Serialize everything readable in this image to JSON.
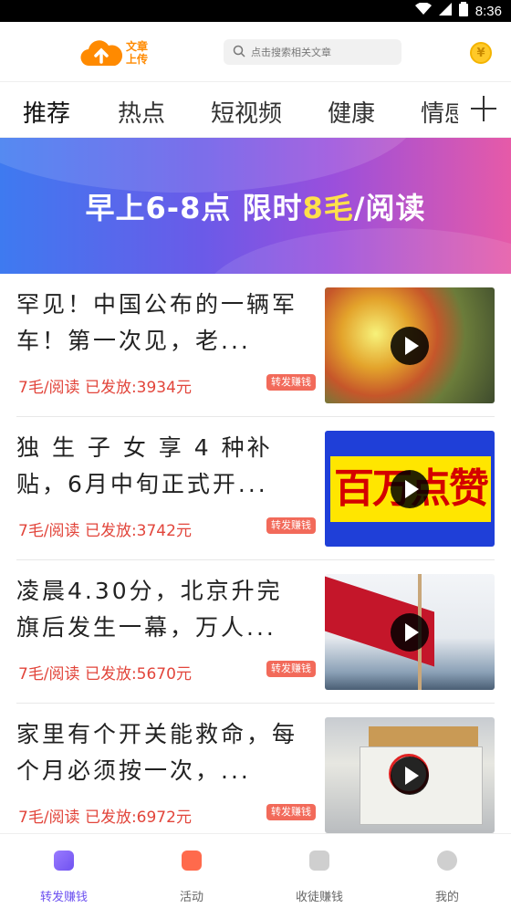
{
  "status": {
    "time": "8:36"
  },
  "header": {
    "logo_line1": "文章",
    "logo_line2": "上传",
    "search_placeholder": "点击搜索相关文章",
    "coin_symbol": "¥"
  },
  "tabs": [
    "推荐",
    "热点",
    "短视频",
    "健康",
    "情感"
  ],
  "banner": {
    "text_before": "早上6-8点   限时",
    "highlight": "8毛",
    "text_after": "/阅读"
  },
  "articles": [
    {
      "title": "罕见！中国公布的一辆军车！第一次见，老...",
      "rate": "7毛/阅读",
      "paid": "已发放:3934元",
      "badge": "转发赚钱"
    },
    {
      "title": "独 生 子 女 享 4 种补贴，6月中旬正式开...",
      "rate": "7毛/阅读",
      "paid": "已发放:3742元",
      "badge": "转发赚钱",
      "thumb_text": "百万点赞"
    },
    {
      "title": "凌晨4.30分，北京升完旗后发生一幕，万人...",
      "rate": "7毛/阅读",
      "paid": "已发放:5670元",
      "badge": "转发赚钱"
    },
    {
      "title": "家里有个开关能救命，每个月必须按一次，...",
      "rate": "7毛/阅读",
      "paid": "已发放:6972元",
      "badge": "转发赚钱"
    }
  ],
  "bottom_nav": [
    {
      "label": "转发赚钱",
      "icon": "article-icon",
      "active": true
    },
    {
      "label": "活动",
      "icon": "gift-icon"
    },
    {
      "label": "收徒赚钱",
      "icon": "user-add-icon"
    },
    {
      "label": "我的",
      "icon": "profile-icon"
    }
  ],
  "colors": {
    "accent": "#6b4ff0",
    "price": "#e2453b",
    "badge": "#f26a5a",
    "logo": "#ff8a00"
  }
}
